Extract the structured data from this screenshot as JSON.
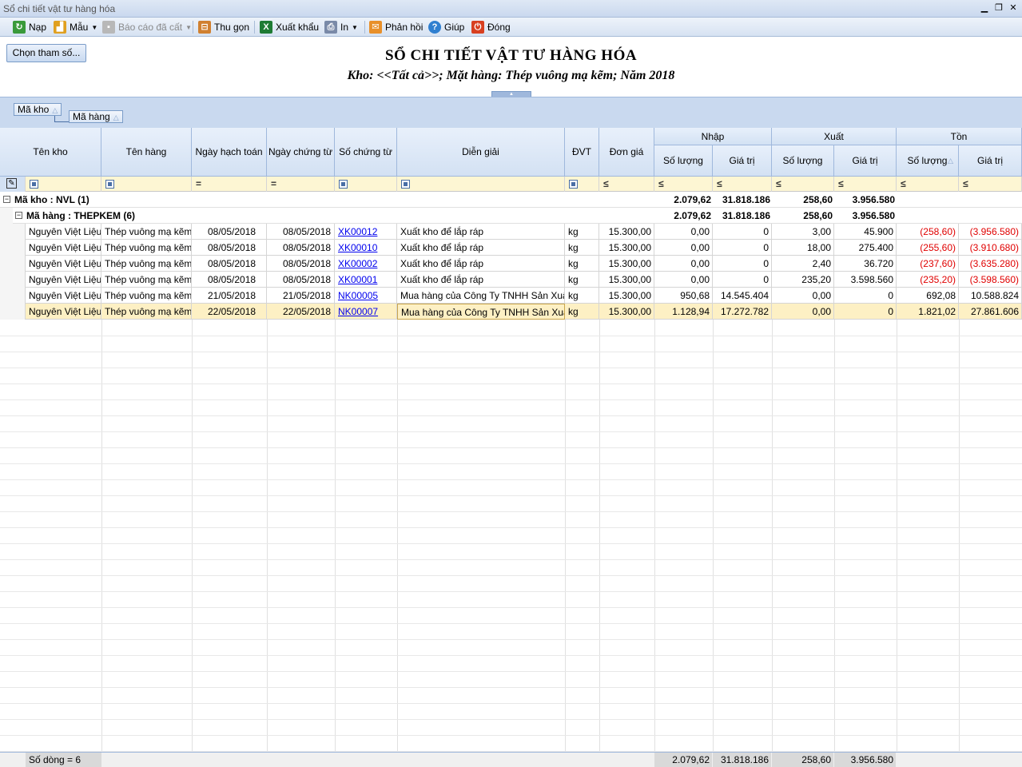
{
  "window": {
    "title": "Sổ chi tiết vật tư hàng hóa"
  },
  "toolbar": {
    "nap": "Nạp",
    "mau": "Mẫu",
    "bao_cao_da_cat": "Báo cáo đã cất",
    "thu_gon": "Thu gọn",
    "xuat_khau": "Xuất khẩu",
    "in": "In",
    "phan_hoi": "Phản hồi",
    "giup": "Giúp",
    "dong": "Đóng"
  },
  "params_button": "Chọn tham số...",
  "report": {
    "title": "SỔ CHI TIẾT VẬT TƯ HÀNG HÓA",
    "subtitle": "Kho: <<Tất cả>>; Mặt hàng: Thép vuông mạ kẽm; Năm 2018"
  },
  "group_panel": {
    "chip1": "Mã kho",
    "chip2": "Mã hàng"
  },
  "columns": {
    "ten_kho": "Tên kho",
    "ten_hang": "Tên hàng",
    "ngay_hach_toan": "Ngày hạch toán",
    "ngay_chung_tu": "Ngày chứng từ",
    "so_chung_tu": "Số chứng từ",
    "dien_giai": "Diễn giải",
    "dvt": "ĐVT",
    "don_gia": "Đơn giá",
    "nhap": "Nhập",
    "xuat": "Xuất",
    "ton": "Tồn",
    "so_luong": "Số lượng",
    "gia_tri": "Giá trị"
  },
  "filter_ops": {
    "eq": "=",
    "le": "≤"
  },
  "groups": {
    "kho": {
      "label": "Mã kho : NVL (1)",
      "nhap_sl": "2.079,62",
      "nhap_gt": "31.818.186",
      "xuat_sl": "258,60",
      "xuat_gt": "3.956.580"
    },
    "hang": {
      "label": "Mã hàng : THEPKEM (6)",
      "nhap_sl": "2.079,62",
      "nhap_gt": "31.818.186",
      "xuat_sl": "258,60",
      "xuat_gt": "3.956.580"
    }
  },
  "rows": [
    {
      "ten_kho": "Nguyên Việt Liệu",
      "ten_hang": "Thép vuông mạ kẽm",
      "ngay_ht": "08/05/2018",
      "ngay_ct": "08/05/2018",
      "so_ct": "XK00012",
      "dien_giai": "Xuất kho để lắp ráp",
      "dvt": "kg",
      "don_gia": "15.300,00",
      "nhap_sl": "0,00",
      "nhap_gt": "0",
      "xuat_sl": "3,00",
      "xuat_gt": "45.900",
      "ton_sl": "(258,60)",
      "ton_gt": "(3.956.580)",
      "neg": true
    },
    {
      "ten_kho": "Nguyên Việt Liệu",
      "ten_hang": "Thép vuông mạ kẽm",
      "ngay_ht": "08/05/2018",
      "ngay_ct": "08/05/2018",
      "so_ct": "XK00010",
      "dien_giai": "Xuất kho để lắp ráp",
      "dvt": "kg",
      "don_gia": "15.300,00",
      "nhap_sl": "0,00",
      "nhap_gt": "0",
      "xuat_sl": "18,00",
      "xuat_gt": "275.400",
      "ton_sl": "(255,60)",
      "ton_gt": "(3.910.680)",
      "neg": true
    },
    {
      "ten_kho": "Nguyên Việt Liệu",
      "ten_hang": "Thép vuông mạ kẽm",
      "ngay_ht": "08/05/2018",
      "ngay_ct": "08/05/2018",
      "so_ct": "XK00002",
      "dien_giai": "Xuất kho để lắp ráp",
      "dvt": "kg",
      "don_gia": "15.300,00",
      "nhap_sl": "0,00",
      "nhap_gt": "0",
      "xuat_sl": "2,40",
      "xuat_gt": "36.720",
      "ton_sl": "(237,60)",
      "ton_gt": "(3.635.280)",
      "neg": true
    },
    {
      "ten_kho": "Nguyên Việt Liệu",
      "ten_hang": "Thép vuông mạ kẽm",
      "ngay_ht": "08/05/2018",
      "ngay_ct": "08/05/2018",
      "so_ct": "XK00001",
      "dien_giai": "Xuất kho để lắp ráp",
      "dvt": "kg",
      "don_gia": "15.300,00",
      "nhap_sl": "0,00",
      "nhap_gt": "0",
      "xuat_sl": "235,20",
      "xuat_gt": "3.598.560",
      "ton_sl": "(235,20)",
      "ton_gt": "(3.598.560)",
      "neg": true
    },
    {
      "ten_kho": "Nguyên Việt Liệu",
      "ten_hang": "Thép vuông mạ kẽm",
      "ngay_ht": "21/05/2018",
      "ngay_ct": "21/05/2018",
      "so_ct": "NK00005",
      "dien_giai": "Mua hàng của Công Ty TNHH Sản Xuất",
      "dvt": "kg",
      "don_gia": "15.300,00",
      "nhap_sl": "950,68",
      "nhap_gt": "14.545.404",
      "xuat_sl": "0,00",
      "xuat_gt": "0",
      "ton_sl": "692,08",
      "ton_gt": "10.588.824",
      "neg": false
    },
    {
      "ten_kho": "Nguyên Việt Liệu",
      "ten_hang": "Thép vuông mạ kẽm",
      "ngay_ht": "22/05/2018",
      "ngay_ct": "22/05/2018",
      "so_ct": "NK00007",
      "dien_giai": "Mua hàng của Công Ty TNHH Sản Xuất",
      "dvt": "kg",
      "don_gia": "15.300,00",
      "nhap_sl": "1.128,94",
      "nhap_gt": "17.272.782",
      "xuat_sl": "0,00",
      "xuat_gt": "0",
      "ton_sl": "1.821,02",
      "ton_gt": "27.861.606",
      "neg": false
    }
  ],
  "footer": {
    "row_count": "Số dòng = 6",
    "nhap_sl": "2.079,62",
    "nhap_gt": "31.818.186",
    "xuat_sl": "258,60",
    "xuat_gt": "3.956.580"
  },
  "colors": {
    "accent": "#4a6fa5",
    "negative": "#e00000",
    "link": "#0000ee",
    "selected_row": "#fdf0c4",
    "filter_row": "#fdf6d3"
  }
}
